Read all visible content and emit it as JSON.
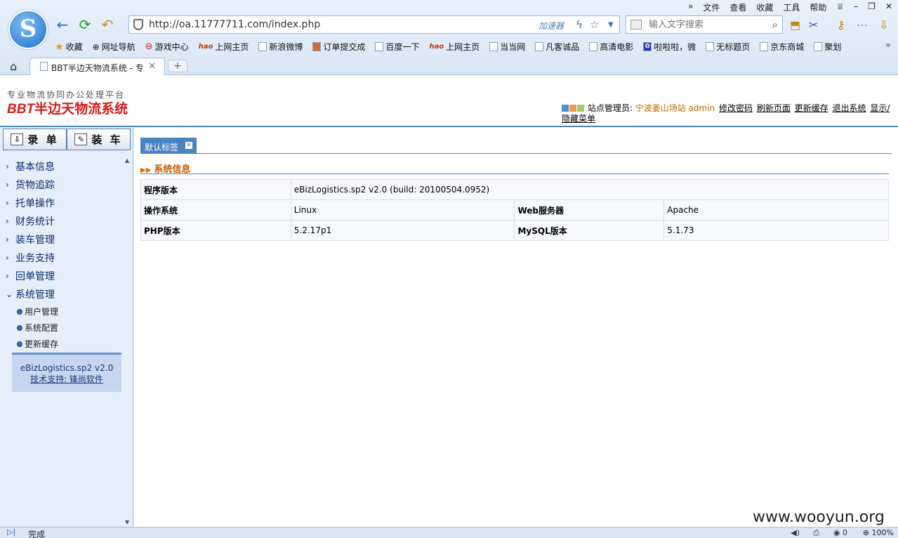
{
  "browser": {
    "menu": [
      "文件",
      "查看",
      "收藏",
      "工具",
      "帮助"
    ],
    "url": "http://oa.11777711.com/index.php",
    "accelerator": "加速器",
    "search_placeholder": "输入文字搜索",
    "bookmarks": [
      "收藏",
      "网址导航",
      "游戏中心",
      "上网主页",
      "新浪微博",
      "订单提交成",
      "百度一下",
      "上网主页",
      "当当网",
      "凡客诚品",
      "高清电影",
      "啦啦啦，微",
      "无标题页",
      "京东商城",
      "聚划"
    ],
    "tab_title": "BBT半边天物流系统 - 专",
    "new_tab": "+",
    "status": "完成",
    "zoom": "100%",
    "counter": "0"
  },
  "app": {
    "slogan": "专业物流协同办公处理平台",
    "brand_prefix": "BBT",
    "brand_name": "半边天物流系统",
    "userbar": {
      "role_label": "站点管理员:",
      "site": "宁波姜山场站",
      "user": "admin",
      "links": [
        "修改密码",
        "刷新页面",
        "更新缓存",
        "退出系统",
        "显示/隐藏菜单"
      ]
    },
    "swatch_colors": [
      "#4d8fd1",
      "#f2994a",
      "#a6c96a"
    ]
  },
  "sidebar": {
    "buttons": [
      "录 单",
      "装 车"
    ],
    "items": [
      "基本信息",
      "货物追踪",
      "托单操作",
      "财务统计",
      "装车管理",
      "业务支持",
      "回单管理",
      "系统管理"
    ],
    "subitems": [
      "用户管理",
      "系统配置",
      "更新缓存"
    ],
    "version": "eBizLogistics.sp2 v2.0",
    "support": "技术支持: 锋尚软件"
  },
  "content": {
    "tab": "默认标签",
    "section_title": "系统信息",
    "rows": [
      {
        "label": "程序版本",
        "value": "eBizLogistics.sp2 v2.0  (build: 20100504.0952)"
      },
      {
        "label": "操作系统",
        "value": "Linux",
        "label2": "Web服务器",
        "value2": "Apache"
      },
      {
        "label": "PHP版本",
        "value": "5.2.17p1",
        "label2": "MySQL版本",
        "value2": "5.1.73"
      }
    ]
  },
  "watermark": "www.wooyun.org"
}
